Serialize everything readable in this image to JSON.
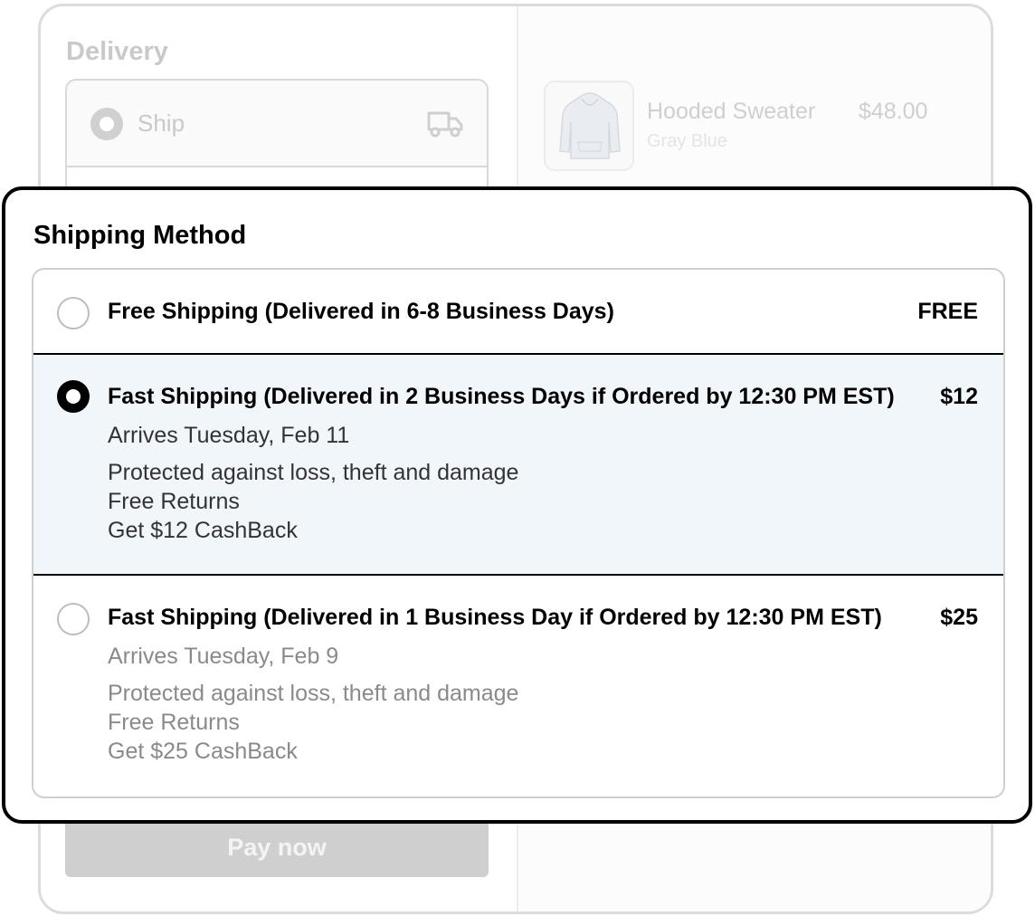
{
  "background": {
    "delivery_heading": "Delivery",
    "ship_option": {
      "label": "Ship",
      "icon": "truck-icon"
    },
    "product": {
      "name": "Hooded Sweater",
      "variant": "Gray Blue",
      "price": "$48.00",
      "icon": "hoodie-icon"
    },
    "pay_button_label": "Pay now"
  },
  "modal": {
    "title": "Shipping Method",
    "options": [
      {
        "title": "Free Shipping (Delivered in 6-8 Business Days)",
        "price": "FREE",
        "selected": false
      },
      {
        "title": "Fast Shipping (Delivered in 2 Business Days if Ordered by 12:30 PM EST)",
        "price": "$12",
        "arrival": "Arrives Tuesday, Feb 11",
        "perks": [
          "Protected against loss, theft and damage",
          "Free Returns",
          "Get $12 CashBack"
        ],
        "selected": true
      },
      {
        "title": "Fast Shipping (Delivered in 1 Business Day if Ordered by 12:30 PM EST)",
        "price": "$25",
        "arrival": "Arrives Tuesday, Feb 9",
        "perks": [
          "Protected against loss, theft and damage",
          "Free Returns",
          "Get $25 CashBack"
        ],
        "selected": false
      }
    ]
  },
  "colors": {
    "selected_background": "#f1f6fa",
    "selected_border": "#000000",
    "dimmed_text": "#c9c9c9",
    "secondary_text": "#8a8a8a"
  }
}
